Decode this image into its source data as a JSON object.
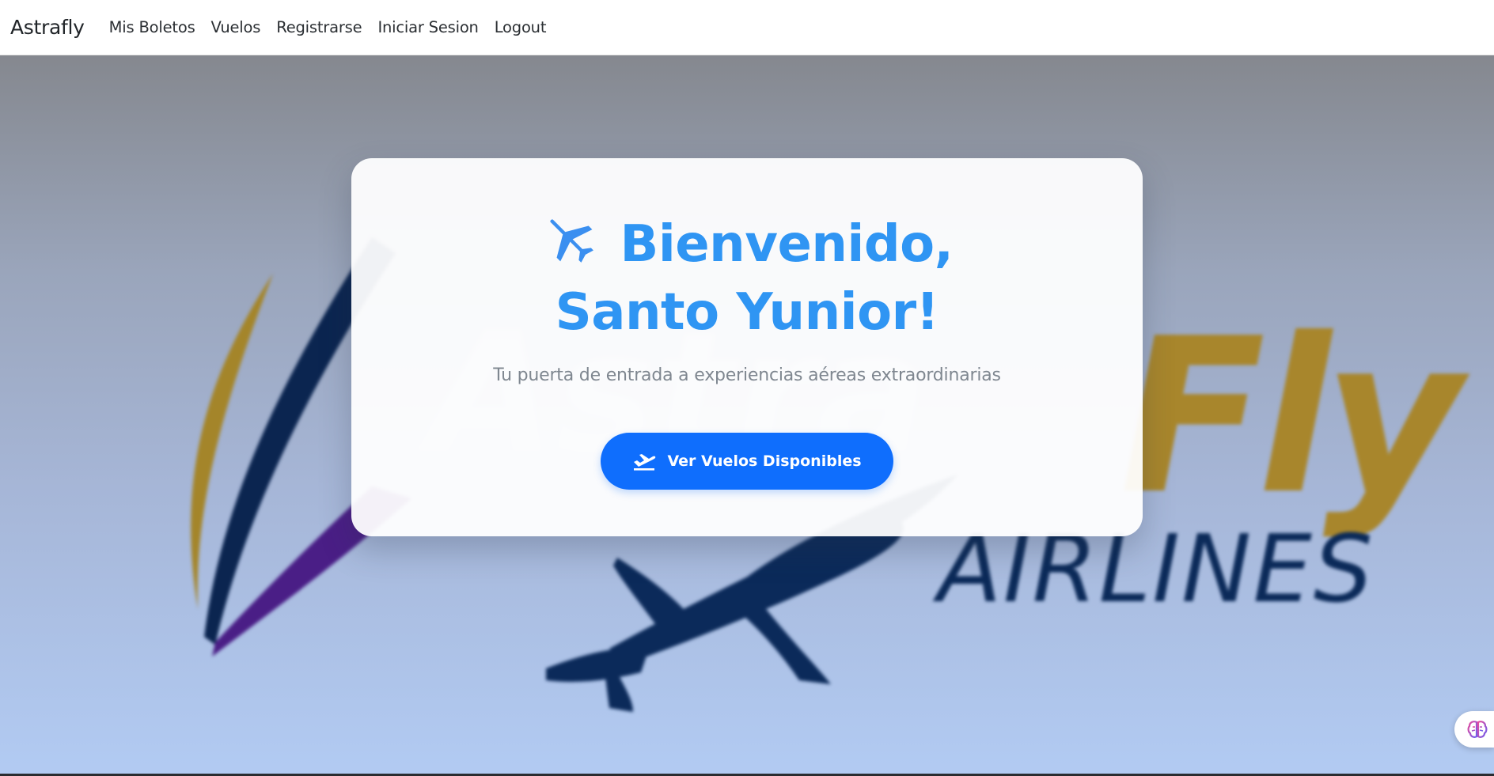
{
  "navbar": {
    "brand": "Astrafly",
    "links": [
      {
        "label": "Mis Boletos"
      },
      {
        "label": "Vuelos"
      },
      {
        "label": "Registrarse"
      },
      {
        "label": "Iniciar Sesion"
      },
      {
        "label": "Logout"
      }
    ]
  },
  "background": {
    "logo_words": {
      "brand_word": "Fly",
      "tagline": "AIRLINES"
    }
  },
  "welcome": {
    "greeting": "Bienvenido,",
    "user_name": "Santo Yunior!",
    "tagline": "Tu puerta de entrada a experiencias aéreas extraordinarias",
    "cta_label": "Ver Vuelos Disponibles",
    "title_icon": "airplane-icon",
    "cta_icon": "plane-departure-icon"
  },
  "helper": {
    "icon": "brain-icon"
  },
  "colors": {
    "accent": "#0f6efd",
    "title": "#2f95f3",
    "logo_gold": "#b08a2a",
    "logo_navy": "#0b2a59",
    "logo_purple": "#4b1f86"
  }
}
